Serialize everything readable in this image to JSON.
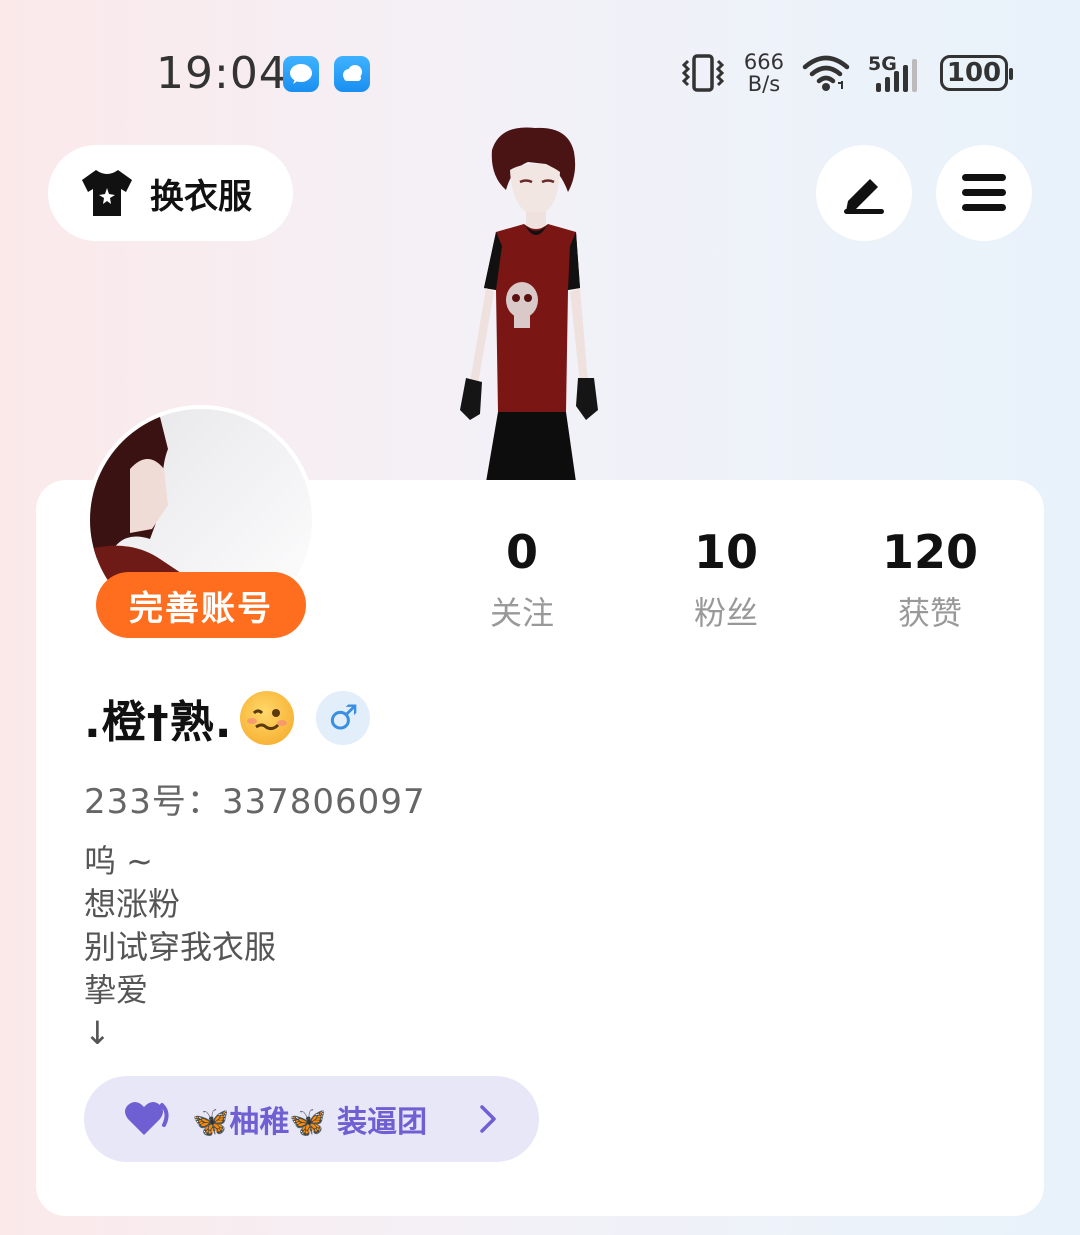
{
  "status_bar": {
    "time": "19:04",
    "speed_value": "666",
    "speed_unit": "B/s",
    "signal_type": "5G",
    "battery": "100",
    "icons": [
      "message-app-icon",
      "cloud-app-icon",
      "vibrate-icon",
      "wifi-icon",
      "signal-icon",
      "battery-icon"
    ]
  },
  "header": {
    "outfit_label": "换衣服",
    "icons": [
      "tshirt-icon",
      "edit-icon",
      "menu-icon"
    ]
  },
  "profile": {
    "complete_label": "完善账号",
    "stats": [
      {
        "value": "0",
        "label": "关注"
      },
      {
        "value": "10",
        "label": "粉丝"
      },
      {
        "value": "120",
        "label": "获赞"
      }
    ],
    "name": ".橙†熟.",
    "gender_symbol": "♂",
    "uid": "233号：337806097",
    "bio": [
      "呜 ~",
      "想涨粉",
      "别试穿我衣服",
      "挚爱",
      "↓"
    ],
    "group_label": "🦋柚稚🦋 装逼团"
  },
  "colors": {
    "accent_orange": "#ff6e1f",
    "group_purple": "#6e5fd2",
    "group_bg": "#e8e7f8"
  }
}
